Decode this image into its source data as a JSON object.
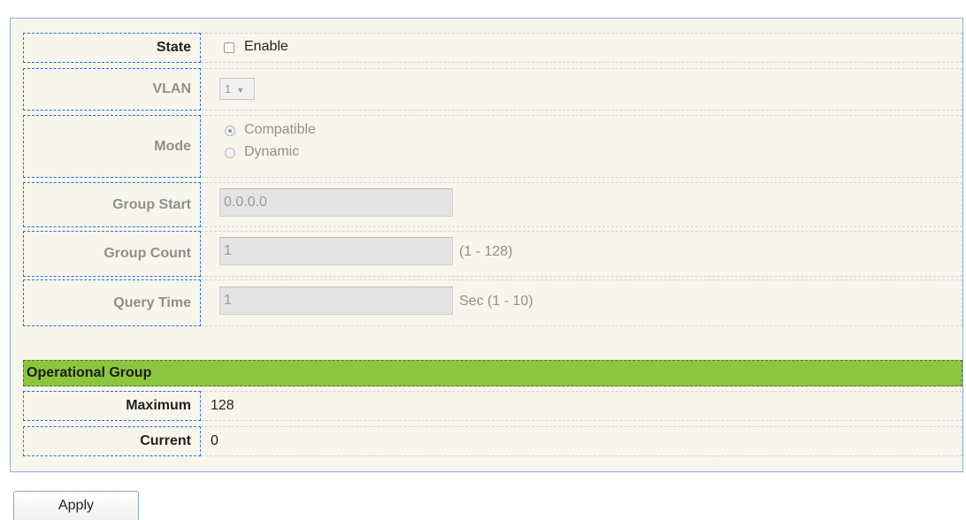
{
  "settings": {
    "state": {
      "label": "State",
      "checkbox_label": "Enable",
      "checked": false
    },
    "vlan": {
      "label": "VLAN",
      "selected": "1"
    },
    "mode": {
      "label": "Mode",
      "options": [
        "Compatible",
        "Dynamic"
      ],
      "selected": "Compatible"
    },
    "group_start": {
      "label": "Group Start",
      "value": "0.0.0.0"
    },
    "group_count": {
      "label": "Group Count",
      "value": "1",
      "hint": "(1 - 128)"
    },
    "query_time": {
      "label": "Query Time",
      "value": "1",
      "hint": "Sec (1 - 10)"
    }
  },
  "operational": {
    "title": "Operational Group",
    "maximum": {
      "label": "Maximum",
      "value": "128"
    },
    "current": {
      "label": "Current",
      "value": "0"
    }
  },
  "apply_label": "Apply",
  "colors": {
    "panel_bg": "#f8f6ec",
    "section_bg": "#8cc63f",
    "label_border": "#2a6fd6",
    "disabled_text": "#8f8f8f"
  }
}
